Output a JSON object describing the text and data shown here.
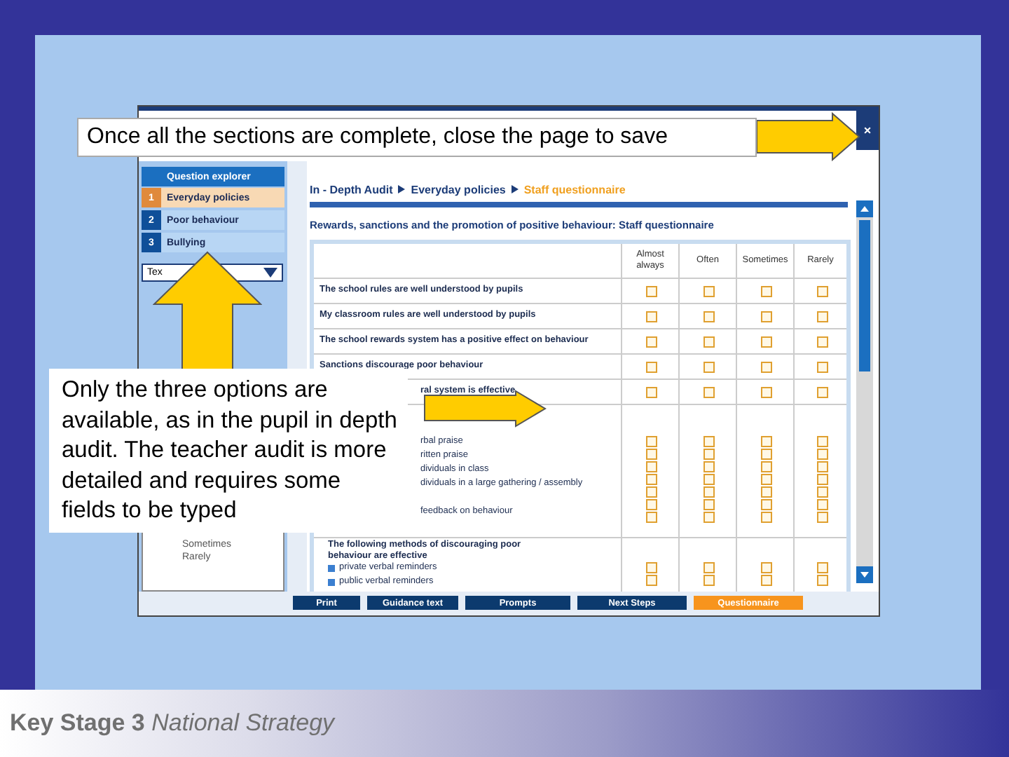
{
  "callouts": [
    {
      "kind": "top",
      "text": "Once all the sections are complete, close the page to save"
    },
    {
      "kind": "left",
      "text": "Only the three options are available, as in the pupil in depth audit. The teacher audit is more detailed and requires some fields to be typed"
    }
  ],
  "window": {
    "close": "×"
  },
  "sidebar": {
    "header": "Question explorer",
    "items": [
      {
        "number": "1",
        "label": "Everyday policies",
        "selected": true
      },
      {
        "number": "2",
        "label": "Poor behaviour",
        "selected": false
      },
      {
        "number": "3",
        "label": "Bullying",
        "selected": false
      }
    ],
    "dropdown": {
      "value": "Tex"
    },
    "options": [
      "Sometimes",
      "Rarely"
    ]
  },
  "breadcrumb": [
    {
      "label": "In - Depth Audit",
      "selected": false
    },
    {
      "label": "Everyday policies",
      "selected": false
    },
    {
      "label": "Staff questionnaire",
      "selected": true
    }
  ],
  "heading": "Rewards, sanctions and the promotion of positive behaviour: Staff questionnaire",
  "table": {
    "columns": [
      "Almost always",
      "Often",
      "Sometimes",
      "Rarely"
    ],
    "rows": [
      {
        "kind": "single",
        "text": "The school rules are well understood by pupils",
        "checked": [
          false,
          false,
          false,
          false
        ]
      },
      {
        "kind": "single",
        "text": "My classroom rules are well understood by pupils",
        "checked": [
          false,
          false,
          false,
          false
        ]
      },
      {
        "kind": "single",
        "text": "The school rewards system has a positive effect on behaviour",
        "checked": [
          false,
          false,
          false,
          false
        ]
      },
      {
        "kind": "single",
        "text": "Sanctions discourage poor behaviour",
        "checked": [
          false,
          false,
          false,
          false
        ]
      },
      {
        "kind": "single",
        "text": "ral system is effective",
        "indent": true,
        "checked": [
          false,
          false,
          false,
          false
        ]
      },
      {
        "kind": "group",
        "lines": [
          {
            "kind": "option",
            "text": "rbal praise",
            "checked": [
              false,
              false,
              false,
              false
            ]
          },
          {
            "kind": "option",
            "text": "ritten praise",
            "checked": [
              false,
              false,
              false,
              false
            ]
          },
          {
            "kind": "option",
            "text": "dividuals in class",
            "checked": [
              false,
              false,
              false,
              false
            ]
          },
          {
            "kind": "option",
            "text": "dividuals in a large gathering / assembly",
            "checked": [
              false,
              false,
              false,
              false
            ]
          },
          {
            "kind": "blank",
            "checked": [
              false,
              false,
              false,
              false
            ]
          },
          {
            "kind": "option",
            "text": "feedback on behaviour",
            "checked": [
              false,
              false,
              false,
              false
            ]
          },
          {
            "kind": "blank",
            "checked": [
              false,
              false,
              false,
              false
            ]
          }
        ]
      },
      {
        "kind": "group",
        "heading": "The following methods of discouraging poor behaviour are effective",
        "lines": [
          {
            "kind": "bullet",
            "text": "private verbal reminders",
            "checked": [
              false,
              false,
              false,
              false
            ]
          },
          {
            "kind": "bullet",
            "text": "public verbal reminders",
            "checked": [
              false,
              false,
              false,
              false
            ]
          }
        ]
      }
    ]
  },
  "buttons": [
    {
      "label": "Print",
      "selected": false
    },
    {
      "label": "Guidance text",
      "selected": false
    },
    {
      "label": "Prompts",
      "selected": false
    },
    {
      "label": "Next Steps",
      "selected": false
    },
    {
      "label": "Questionnaire",
      "selected": true
    }
  ],
  "footer": "**Key Stage 3** *National Strategy*"
}
